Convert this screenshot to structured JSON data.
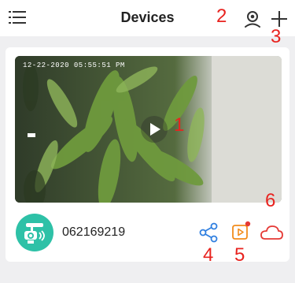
{
  "header": {
    "title": "Devices"
  },
  "camera": {
    "timestamp": "12-22-2020 05:55:51 PM",
    "device_id": "062169219"
  },
  "annotations": [
    "1",
    "2",
    "3",
    "4",
    "5",
    "6"
  ],
  "colors": {
    "annotation": "#e8231f",
    "accent_blue": "#2f7fe0",
    "accent_orange": "#f28c1b",
    "accent_red": "#e53935",
    "avatar": "#2ec1a7"
  }
}
